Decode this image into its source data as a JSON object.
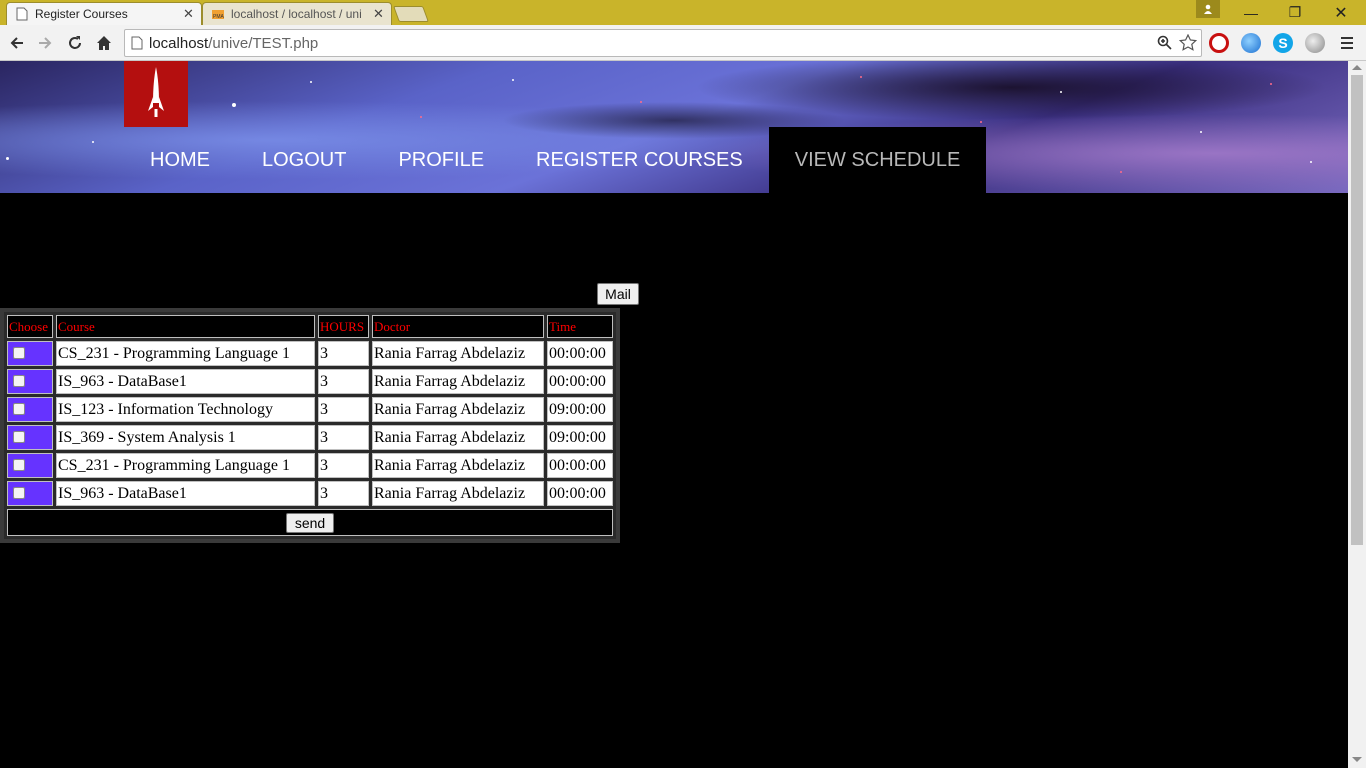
{
  "browser": {
    "tabs": [
      {
        "title": "Register Courses",
        "active": true
      },
      {
        "title": "localhost / localhost / uni",
        "active": false
      }
    ],
    "url_host": "localhost",
    "url_path": "/unive/TEST.php",
    "icons": {
      "back": "arrow-left-icon",
      "forward": "arrow-right-icon",
      "reload": "reload-icon",
      "home": "home-icon",
      "zoom": "zoom-icon",
      "bookmark": "star-icon",
      "menu": "hamburger-icon"
    }
  },
  "site": {
    "logo_icon": "rocket-icon",
    "nav": [
      {
        "label": "HOME",
        "active": false
      },
      {
        "label": "LOGOUT",
        "active": false
      },
      {
        "label": "PROFILE",
        "active": false
      },
      {
        "label": "REGISTER COURSES",
        "active": false
      },
      {
        "label": "VIEW SCHEDULE",
        "active": true
      }
    ],
    "mail_label": "Mail",
    "send_label": "send"
  },
  "table": {
    "headers": [
      "Choose",
      "Course",
      "HOURS",
      "Doctor",
      "Time"
    ],
    "rows": [
      {
        "course": "CS_231 - Programming Language 1",
        "hours": "3",
        "doctor": "Rania Farrag Abdelaziz",
        "time": "00:00:00"
      },
      {
        "course": "IS_963 - DataBase1",
        "hours": "3",
        "doctor": "Rania Farrag Abdelaziz",
        "time": "00:00:00"
      },
      {
        "course": "IS_123 - Information Technology",
        "hours": "3",
        "doctor": "Rania Farrag Abdelaziz",
        "time": "09:00:00"
      },
      {
        "course": "IS_369 - System Analysis 1",
        "hours": "3",
        "doctor": "Rania Farrag Abdelaziz",
        "time": "09:00:00"
      },
      {
        "course": "CS_231 - Programming Language 1",
        "hours": "3",
        "doctor": "Rania Farrag Abdelaziz",
        "time": "00:00:00"
      },
      {
        "course": "IS_963 - DataBase1",
        "hours": "3",
        "doctor": "Rania Farrag Abdelaziz",
        "time": "00:00:00"
      }
    ]
  },
  "colors": {
    "header_text": "#ff0000",
    "choose_cell": "#6633ff",
    "logo_bg": "#b40f0f",
    "titlebar": "#c9b42a"
  }
}
